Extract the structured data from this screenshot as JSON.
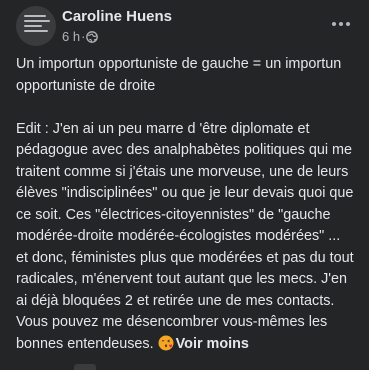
{
  "post": {
    "author": "Caroline Huens",
    "time": "6 h",
    "separator": " · ",
    "privacy_icon": "globe-icon",
    "paragraphs": [
      "Un importun opportuniste de gauche = un importun opportuniste de droite",
      "Edit : J'en ai un peu marre d 'être diplomate et pédagogue avec des analphabètes politiques qui me traitent comme si j'étais une morveuse, une de leurs élèves \"indisciplinées\" ou que je leur devais quoi que ce soit. Ces \"électrices-citoyennistes\" de \"gauche modérée-droite modérée-écologistes modérées\" ... et donc, féministes plus que modérées et pas du tout radicales, m'énervent tout autant que les mecs. J'en ai déjà bloquées 2 et retirée une de mes contacts. Vous pouvez me désencombrer vous-mêmes les bonnes entendeuses. "
    ],
    "emoji": "kissing-face-icon",
    "see_less": "Voir moins"
  },
  "colors": {
    "background": "#242526",
    "text": "#e4e6eb",
    "secondary": "#b0b3b8",
    "emoji": "#f5a623"
  }
}
